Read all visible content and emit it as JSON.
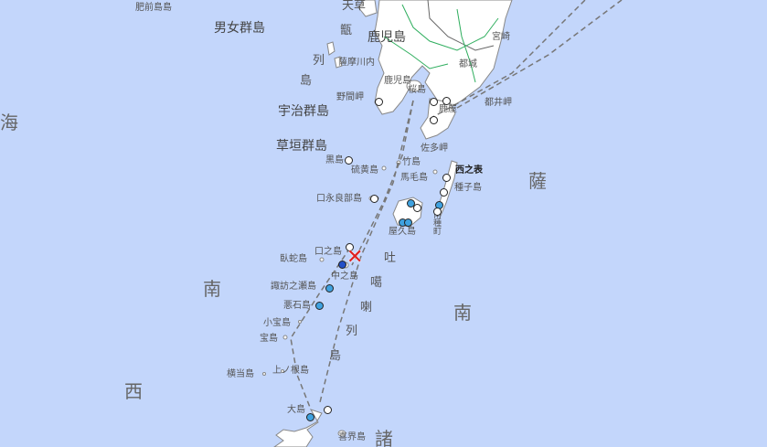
{
  "colors": {
    "sea": "#c3d6fb",
    "land": "#ffffff",
    "coast": "#777777",
    "route": "#777777",
    "intensity_1": "#ffffff",
    "intensity_2": "#3fa2e0",
    "intensity_3": "#2350c8",
    "epicenter": "#e02020"
  },
  "sea_labels": {
    "sea_left": "海",
    "satsunan_top": "薩",
    "satsunan_south": "南",
    "nansei_1": "南",
    "nansei_2": "西",
    "nansei_3": "諸"
  },
  "island_groups": {
    "danjo": "男女群島",
    "uji": "宇治群島",
    "kusagaki": "草垣群島",
    "tokara_1": "吐",
    "tokara_2": "噶",
    "tokara_3": "喇",
    "tokara_4": "列",
    "tokara_5": "島",
    "koshiki": [
      "甑",
      "列",
      "島"
    ]
  },
  "places": {
    "hizen": "肥前島島",
    "amakusa": "天草",
    "kagoshima_pref": "鹿児島",
    "miyazaki": "宮崎",
    "miyakonojo": "都城",
    "satsumasendai": "薩摩川内",
    "kagoshima_city": "鹿児島",
    "sakurajima": "桜島",
    "nomamisaki": "野間岬",
    "kanoya": "鹿屋",
    "toimisaki": "都井岬",
    "satamisaki": "佐多岬",
    "kuroshima": "黒島",
    "takeshima": "竹島",
    "iojima": "硫黄島",
    "mageshima": "馬毛島",
    "nishinoomote": "西之表",
    "tanegashima": "種子島",
    "kuchinoerabu": "口永良部島",
    "yakushima": "屋久島",
    "kuchinoshima": "口之島",
    "gajajima": "臥蛇島",
    "nakanoshima": "中之島",
    "suwanosejima": "諏訪之瀬島",
    "akusekijima": "悪石島",
    "kodakarajima": "小宝島",
    "takarajima": "宝島",
    "yokoatejima": "横当島",
    "kaminonejima": "上ノ根島",
    "oshima": "大島",
    "kikaijima": "喜界島",
    "minamitane": "南種町"
  },
  "stations": [
    {
      "name": "nomamisaki-station",
      "level": 1
    },
    {
      "name": "sakurajima-station",
      "level": 1
    },
    {
      "name": "kanoya-station-1",
      "level": 1
    },
    {
      "name": "kanoya-station-2",
      "level": 1
    },
    {
      "name": "kuroshima-station",
      "level": 1
    },
    {
      "name": "nishinoomote-station",
      "level": 1
    },
    {
      "name": "tanegashima-station",
      "level": 1
    },
    {
      "name": "minamitane-station-1",
      "level": 2
    },
    {
      "name": "minamitane-station-2",
      "level": 1
    },
    {
      "name": "kuchinoerabu-station",
      "level": 1
    },
    {
      "name": "yakushima-station-1",
      "level": 2
    },
    {
      "name": "yakushima-station-2",
      "level": 1
    },
    {
      "name": "yakushima-station-3",
      "level": 2
    },
    {
      "name": "yakushima-station-4",
      "level": 2
    },
    {
      "name": "kuchinoshima-station",
      "level": 1
    },
    {
      "name": "nakanoshima-station",
      "level": 3
    },
    {
      "name": "suwanosejima-station",
      "level": 2
    },
    {
      "name": "akusekijima-station",
      "level": 2
    },
    {
      "name": "oshima-station-1",
      "level": 1
    },
    {
      "name": "oshima-station-2",
      "level": 2
    }
  ],
  "epicenter": {
    "symbol": "✕"
  }
}
